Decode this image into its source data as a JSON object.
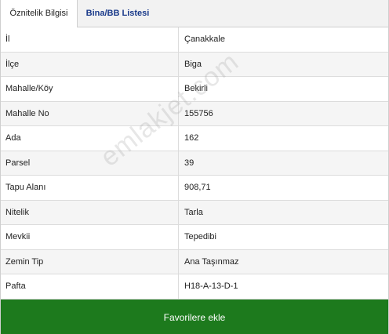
{
  "tabs": [
    {
      "label": "Öznitelik Bilgisi",
      "active": true
    },
    {
      "label": "Bina/BB Listesi",
      "active": false
    }
  ],
  "rows": [
    {
      "label": "İl",
      "value": "Çanakkale"
    },
    {
      "label": "İlçe",
      "value": "Biga"
    },
    {
      "label": "Mahalle/Köy",
      "value": "Bekirli"
    },
    {
      "label": "Mahalle No",
      "value": "155756"
    },
    {
      "label": "Ada",
      "value": "162"
    },
    {
      "label": "Parsel",
      "value": "39"
    },
    {
      "label": "Tapu Alanı",
      "value": "908,71"
    },
    {
      "label": "Nitelik",
      "value": "Tarla"
    },
    {
      "label": "Mevkii",
      "value": "Tepedibi"
    },
    {
      "label": "Zemin Tip",
      "value": "Ana Taşınmaz"
    },
    {
      "label": "Pafta",
      "value": "H18-A-13-D-1"
    }
  ],
  "watermark": "emlakjet.com",
  "favorite_button": {
    "label": "Favorilere ekle"
  },
  "colors": {
    "button_bg": "#1d7a1d",
    "tab_link": "#1a3a8a"
  }
}
